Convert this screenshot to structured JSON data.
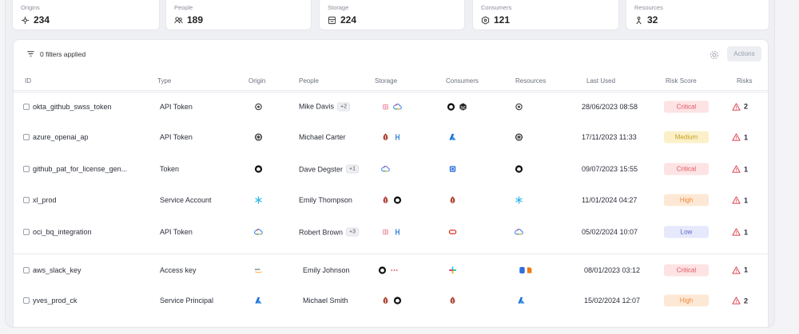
{
  "stats": [
    {
      "label": "Origins",
      "value": "234",
      "icon": "origin-icon"
    },
    {
      "label": "People",
      "value": "189",
      "icon": "people-icon"
    },
    {
      "label": "Storage",
      "value": "224",
      "icon": "storage-icon"
    },
    {
      "label": "Consumers",
      "value": "121",
      "icon": "consumers-icon"
    },
    {
      "label": "Resources",
      "value": "32",
      "icon": "resources-icon"
    }
  ],
  "toolbar": {
    "filters_label": "0 filters applied",
    "actions_label": "Actions"
  },
  "columns": {
    "id": "ID",
    "type": "Type",
    "origin": "Origin",
    "people": "People",
    "storage": "Storage",
    "consumers": "Consumers",
    "resources": "Resources",
    "last_used": "Last Used",
    "risk_score": "Risk Score",
    "risks": "Risks"
  },
  "colors": {
    "critical": "#e05661",
    "medium": "#c4a227",
    "high": "#ee8b3a",
    "low": "#5966c8",
    "risk_icon": "#e0424f"
  },
  "rows": [
    {
      "id": "okta_github_swss_token",
      "type": "API Token",
      "origin": "okta-icon",
      "people": "Mike Davis",
      "people_more": "+2",
      "storage": [
        "pink-app-icon",
        "google-cloud-icon"
      ],
      "consumers": [
        "github-icon",
        "databricks-icon"
      ],
      "resources": "okta-icon",
      "last_used": "28/06/2023 08:58",
      "risk_score": "Critical",
      "risks": "2"
    },
    {
      "id": "azure_openai_ap",
      "type": "API Token",
      "origin": "openai-icon",
      "people": "Michael Carter",
      "people_more": "",
      "storage": [
        "vault-icon",
        "hashicorp-icon"
      ],
      "consumers": [
        "azure-icon"
      ],
      "resources": "openai-icon",
      "last_used": "17/11/2023 11:33",
      "risk_score": "Medium",
      "risks": "1"
    },
    {
      "id": "github_pat_for_license_gen...",
      "type": "Token",
      "origin": "github-icon",
      "people": "Dave Degster",
      "people_more": "+1",
      "storage": [
        "google-cloud-icon"
      ],
      "consumers": [
        "aws-icon"
      ],
      "resources": "github-icon",
      "last_used": "09/07/2023 15:55",
      "risk_score": "Critical",
      "risks": "1"
    },
    {
      "id": "xl_prod",
      "type": "Service Account",
      "origin": "snowflake-icon",
      "people": "Emily Thompson",
      "people_more": "",
      "storage": [
        "vault-icon",
        "github-icon"
      ],
      "consumers": [
        "vault-icon"
      ],
      "resources": "snowflake-icon",
      "last_used": "11/01/2024 04:27",
      "risk_score": "High",
      "risks": "1"
    },
    {
      "id": "oci_bq_integration",
      "type": "API Token",
      "origin": "google-cloud-icon",
      "people": "Robert Brown",
      "people_more": "+3",
      "storage": [
        "pink-app-icon",
        "hashicorp-icon"
      ],
      "consumers": [
        "oracle-icon"
      ],
      "resources": "google-cloud-icon",
      "last_used": "05/02/2024 10:07",
      "risk_score": "Low",
      "risks": "1"
    },
    {
      "id": "aws_slack_key",
      "type": "Access key",
      "origin": "aws-logo-icon",
      "people": "Emily Johnson",
      "people_more": "",
      "storage": [
        "github-icon",
        "dots-icon"
      ],
      "consumers": [
        "slack-icon"
      ],
      "resources": "aws-db-icon",
      "last_used": "08/01/2023 03:12",
      "risk_score": "Critical",
      "risks": "1"
    },
    {
      "id": "yves_prod_ck",
      "type": "Service Principal",
      "origin": "azure-icon",
      "people": "Michael Smith",
      "people_more": "",
      "storage": [
        "vault-icon",
        "github-icon"
      ],
      "consumers": [
        "vault-icon"
      ],
      "resources": "azure-icon",
      "last_used": "15/02/2024 12:07",
      "risk_score": "High",
      "risks": "2"
    }
  ]
}
